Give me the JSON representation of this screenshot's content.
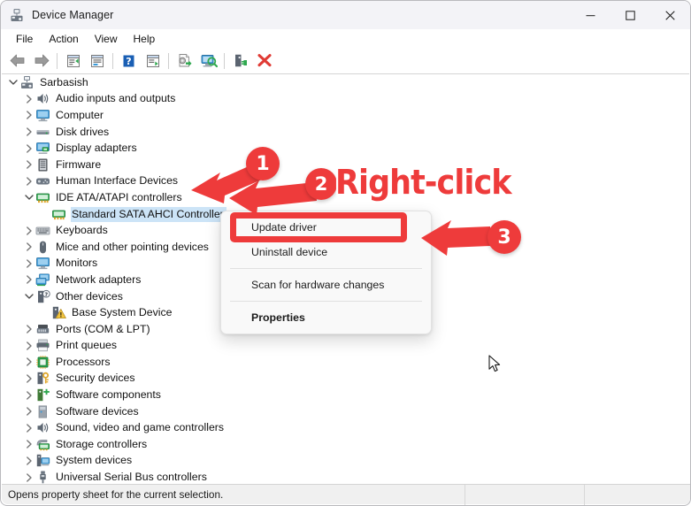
{
  "window": {
    "title": "Device Manager",
    "icon": "device-manager-icon",
    "caption": {
      "minimize": "minimize-icon",
      "maximize": "maximize-icon",
      "close": "close-icon"
    }
  },
  "menubar": {
    "items": [
      {
        "label": "File"
      },
      {
        "label": "Action"
      },
      {
        "label": "View"
      },
      {
        "label": "Help"
      }
    ]
  },
  "toolbar": {
    "buttons": [
      {
        "name": "back-icon"
      },
      {
        "name": "forward-icon"
      },
      {
        "name": "separator"
      },
      {
        "name": "show-hidden-devices-icon"
      },
      {
        "name": "properties-icon"
      },
      {
        "name": "separator"
      },
      {
        "name": "help-icon"
      },
      {
        "name": "view-devices-icon"
      },
      {
        "name": "separator"
      },
      {
        "name": "update-driver-icon"
      },
      {
        "name": "scan-for-hardware-changes-icon"
      },
      {
        "name": "separator"
      },
      {
        "name": "disable-device-icon"
      },
      {
        "name": "uninstall-device-icon"
      }
    ]
  },
  "tree": {
    "nodes": [
      {
        "label": "Sarbasish",
        "indent": 0,
        "state": "expanded",
        "icon": "computer-root-icon",
        "selected": false
      },
      {
        "label": "Audio inputs and outputs",
        "indent": 1,
        "state": "collapsed",
        "icon": "speaker-icon",
        "selected": false
      },
      {
        "label": "Computer",
        "indent": 1,
        "state": "collapsed",
        "icon": "monitor-icon",
        "selected": false
      },
      {
        "label": "Disk drives",
        "indent": 1,
        "state": "collapsed",
        "icon": "disk-drive-icon",
        "selected": false
      },
      {
        "label": "Display adapters",
        "indent": 1,
        "state": "collapsed",
        "icon": "display-adapter-icon",
        "selected": false
      },
      {
        "label": "Firmware",
        "indent": 1,
        "state": "collapsed",
        "icon": "firmware-icon",
        "selected": false
      },
      {
        "label": "Human Interface Devices",
        "indent": 1,
        "state": "collapsed",
        "icon": "gamepad-icon",
        "selected": false
      },
      {
        "label": "IDE ATA/ATAPI controllers",
        "indent": 1,
        "state": "expanded",
        "icon": "ide-controller-icon",
        "selected": false
      },
      {
        "label": "Standard SATA AHCI Controller",
        "indent": 2,
        "state": "leaf",
        "icon": "ide-controller-icon",
        "selected": true
      },
      {
        "label": "Keyboards",
        "indent": 1,
        "state": "collapsed",
        "icon": "keyboard-icon",
        "selected": false
      },
      {
        "label": "Mice and other pointing devices",
        "indent": 1,
        "state": "collapsed",
        "icon": "mouse-icon",
        "selected": false
      },
      {
        "label": "Monitors",
        "indent": 1,
        "state": "collapsed",
        "icon": "monitor-icon",
        "selected": false
      },
      {
        "label": "Network adapters",
        "indent": 1,
        "state": "collapsed",
        "icon": "network-adapter-icon",
        "selected": false
      },
      {
        "label": "Other devices",
        "indent": 1,
        "state": "expanded",
        "icon": "other-device-icon",
        "selected": false
      },
      {
        "label": "Base System Device",
        "indent": 2,
        "state": "leaf",
        "icon": "unknown-device-warning-icon",
        "selected": false
      },
      {
        "label": "Ports (COM & LPT)",
        "indent": 1,
        "state": "collapsed",
        "icon": "port-icon",
        "selected": false
      },
      {
        "label": "Print queues",
        "indent": 1,
        "state": "collapsed",
        "icon": "printer-icon",
        "selected": false
      },
      {
        "label": "Processors",
        "indent": 1,
        "state": "collapsed",
        "icon": "processor-icon",
        "selected": false
      },
      {
        "label": "Security devices",
        "indent": 1,
        "state": "collapsed",
        "icon": "security-device-icon",
        "selected": false
      },
      {
        "label": "Software components",
        "indent": 1,
        "state": "collapsed",
        "icon": "software-component-icon",
        "selected": false
      },
      {
        "label": "Software devices",
        "indent": 1,
        "state": "collapsed",
        "icon": "software-device-icon",
        "selected": false
      },
      {
        "label": "Sound, video and game controllers",
        "indent": 1,
        "state": "collapsed",
        "icon": "speaker-icon",
        "selected": false
      },
      {
        "label": "Storage controllers",
        "indent": 1,
        "state": "collapsed",
        "icon": "storage-controller-icon",
        "selected": false
      },
      {
        "label": "System devices",
        "indent": 1,
        "state": "collapsed",
        "icon": "system-device-icon",
        "selected": false
      },
      {
        "label": "Universal Serial Bus controllers",
        "indent": 1,
        "state": "collapsed",
        "icon": "usb-icon",
        "selected": false
      }
    ]
  },
  "context_menu": {
    "items": [
      {
        "label": "Update driver",
        "bold": false,
        "type": "item",
        "highlighted": true
      },
      {
        "label": "Uninstall device",
        "bold": false,
        "type": "item",
        "highlighted": false
      },
      {
        "type": "separator"
      },
      {
        "label": "Scan for hardware changes",
        "bold": false,
        "type": "item",
        "highlighted": false
      },
      {
        "type": "separator"
      },
      {
        "label": "Properties",
        "bold": true,
        "type": "item",
        "highlighted": false
      }
    ]
  },
  "statusbar": {
    "message": "Opens property sheet for the current selection.",
    "pane2": "",
    "pane3": ""
  },
  "annotations": {
    "accent_color": "#ee3b3b",
    "badges": [
      {
        "label": "1"
      },
      {
        "label": "2"
      },
      {
        "label": "3"
      }
    ],
    "callout_text": "Right-click"
  }
}
